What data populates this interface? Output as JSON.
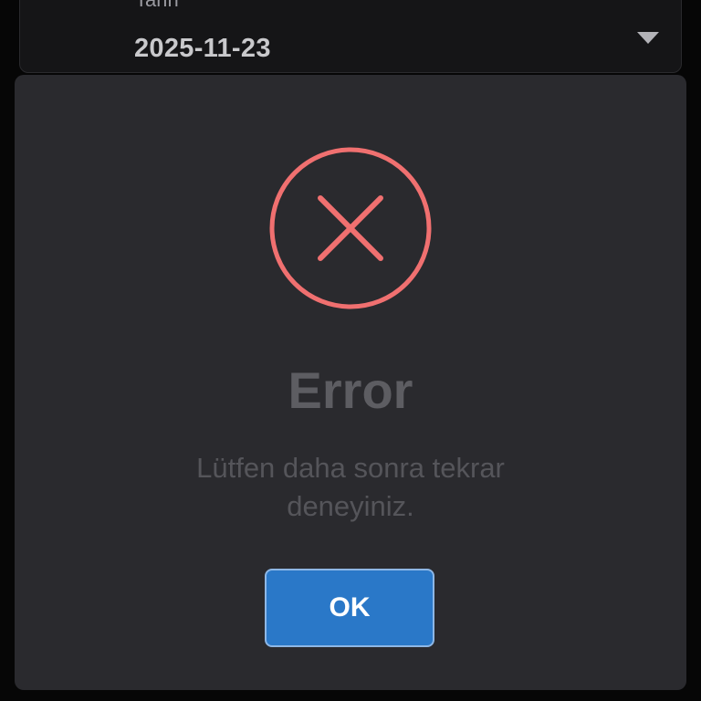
{
  "background_form": {
    "date_field": {
      "label": "Tarih",
      "value": "2025-11-23",
      "arrow_icon": "chevron-down-icon"
    }
  },
  "dialog": {
    "icon": "error-circle-x-icon",
    "title": "Error",
    "message": "Lütfen daha sonra tekrar deneyiniz.",
    "ok_label": "OK"
  },
  "colors": {
    "error_accent": "#f07070",
    "button_primary": "#2a78c8",
    "dialog_background": "#2a2a2e",
    "page_background": "#060606"
  }
}
